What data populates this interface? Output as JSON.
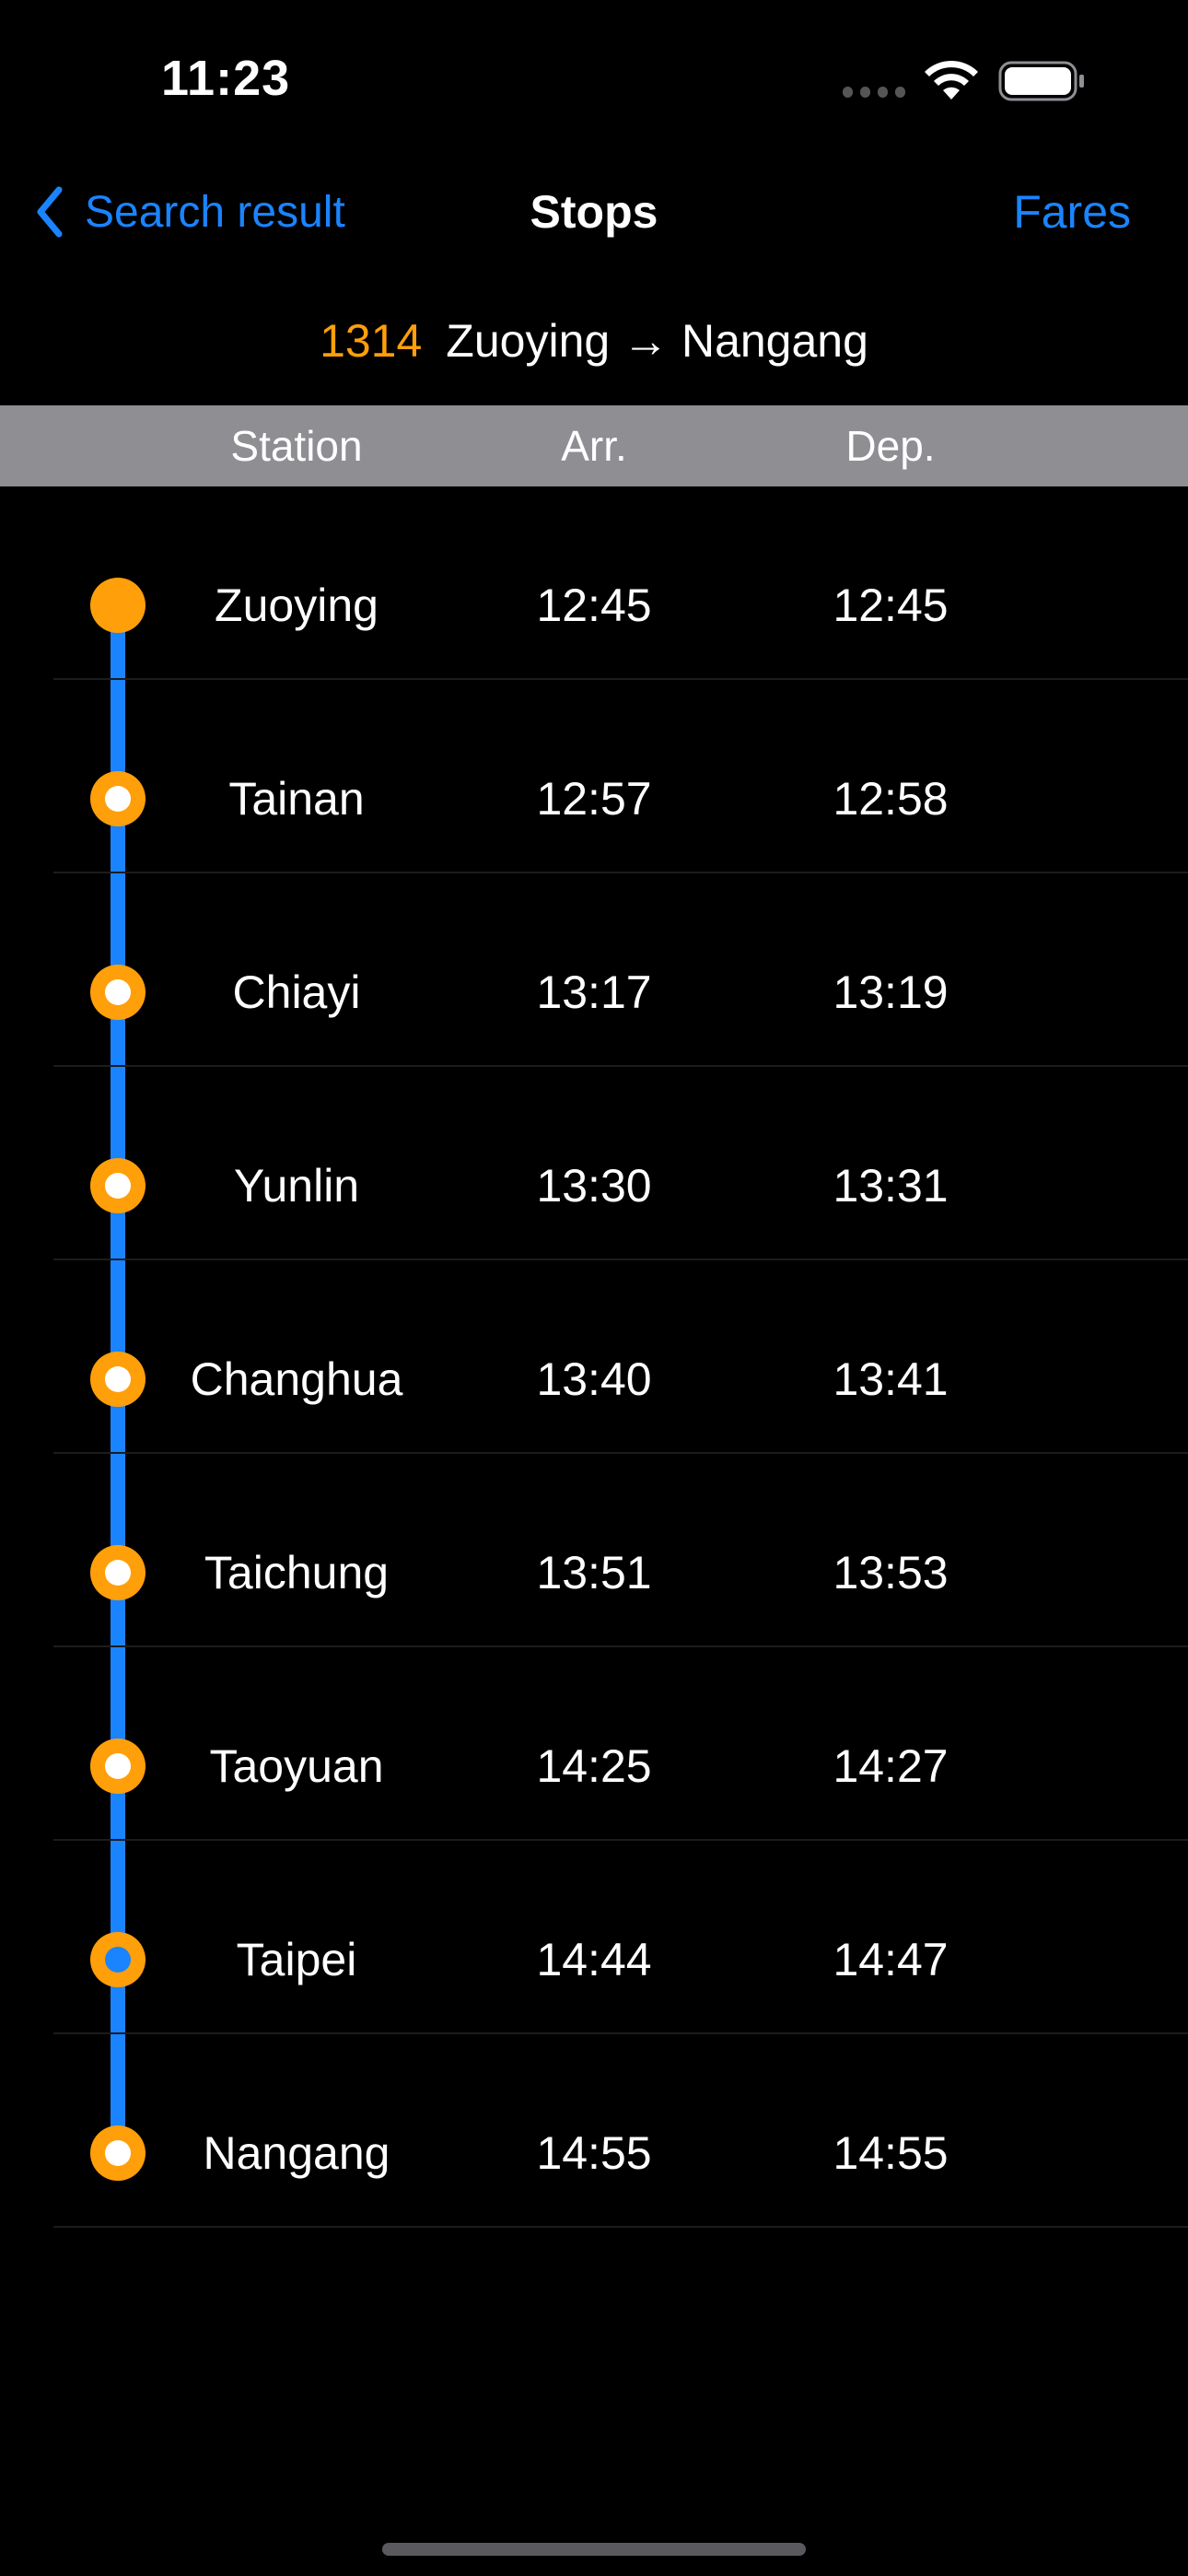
{
  "status_bar": {
    "time": "11:23"
  },
  "nav": {
    "back_label": "Search result",
    "title": "Stops",
    "right_label": "Fares"
  },
  "route": {
    "train_number": "1314",
    "description": "Zuoying → Nangang"
  },
  "columns": {
    "station": "Station",
    "arrival": "Arr.",
    "departure": "Dep."
  },
  "stops": [
    {
      "station": "Zuoying",
      "arr": "12:45",
      "dep": "12:45",
      "marker": "origin"
    },
    {
      "station": "Tainan",
      "arr": "12:57",
      "dep": "12:58",
      "marker": "stop"
    },
    {
      "station": "Chiayi",
      "arr": "13:17",
      "dep": "13:19",
      "marker": "stop"
    },
    {
      "station": "Yunlin",
      "arr": "13:30",
      "dep": "13:31",
      "marker": "stop"
    },
    {
      "station": "Changhua",
      "arr": "13:40",
      "dep": "13:41",
      "marker": "stop"
    },
    {
      "station": "Taichung",
      "arr": "13:51",
      "dep": "13:53",
      "marker": "stop"
    },
    {
      "station": "Taoyuan",
      "arr": "14:25",
      "dep": "14:27",
      "marker": "stop"
    },
    {
      "station": "Taipei",
      "arr": "14:44",
      "dep": "14:47",
      "marker": "current"
    },
    {
      "station": "Nangang",
      "arr": "14:55",
      "dep": "14:55",
      "marker": "stop"
    }
  ],
  "colors": {
    "accent": "#1a84ff",
    "train_number": "#ff9f0a",
    "header_bg": "#8e8e93"
  }
}
